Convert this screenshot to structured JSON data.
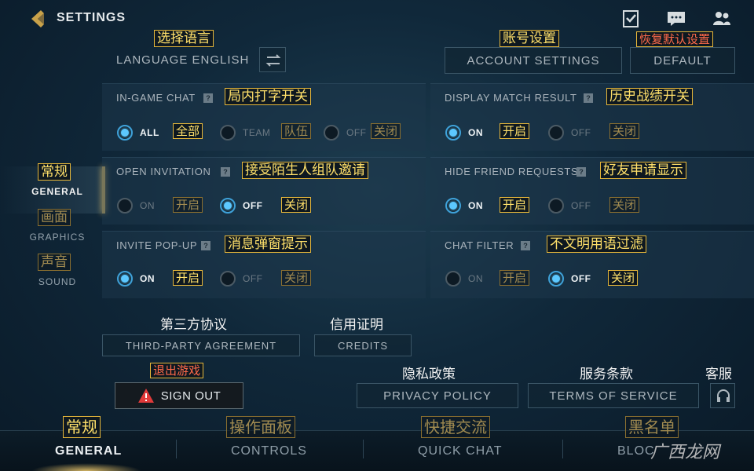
{
  "header": {
    "title": "SETTINGS",
    "icons": [
      "back-icon",
      "checklist-icon",
      "chat-bubble-icon",
      "friends-icon"
    ]
  },
  "top": {
    "language_label": "LANGUAGE ENGLISH",
    "language_cn": "选择语言",
    "swap_icon": "swap-icon",
    "account_settings": "ACCOUNT SETTINGS",
    "account_cn": "账号设置",
    "default": "DEFAULT",
    "default_cn": "恢复默认设置"
  },
  "left_nav": {
    "general": {
      "en": "GENERAL",
      "cn": "常规"
    },
    "graphics": {
      "en": "GRAPHICS",
      "cn": "画面"
    },
    "sound": {
      "en": "SOUND",
      "cn": "声音"
    }
  },
  "options": {
    "ingame_chat": {
      "title": "IN-GAME CHAT",
      "cn": "局内打字开关",
      "opt1": "ALL",
      "opt1_cn": "全部",
      "opt2": "TEAM",
      "opt2_cn": "队伍",
      "opt3": "OFF",
      "opt3_cn": "关闭"
    },
    "display_match": {
      "title": "DISPLAY MATCH RESULT",
      "cn": "历史战绩开关",
      "opt1": "ON",
      "opt1_cn": "开启",
      "opt2": "OFF",
      "opt2_cn": "关闭"
    },
    "open_invitation": {
      "title": "OPEN INVITATION",
      "cn": "接受陌生人组队邀请",
      "opt1": "ON",
      "opt1_cn": "开启",
      "opt2": "OFF",
      "opt2_cn": "关闭"
    },
    "hide_friend": {
      "title": "HIDE FRIEND REQUESTS",
      "cn": "好友申请显示",
      "opt1": "ON",
      "opt1_cn": "开启",
      "opt2": "OFF",
      "opt2_cn": "关闭"
    },
    "invite_popup": {
      "title": "INVITE POP-UP",
      "cn": "消息弹窗提示",
      "opt1": "ON",
      "opt1_cn": "开启",
      "opt2": "OFF",
      "opt2_cn": "关闭"
    },
    "chat_filter": {
      "title": "CHAT FILTER",
      "cn": "不文明用语过滤",
      "opt1": "ON",
      "opt1_cn": "开启",
      "opt2": "OFF",
      "opt2_cn": "关闭"
    }
  },
  "links": {
    "third_party_cn": "第三方协议",
    "third_party": "THIRD-PARTY AGREEMENT",
    "credits_cn": "信用证明",
    "credits": "CREDITS",
    "signout_cn": "退出游戏",
    "signout": "SIGN OUT",
    "privacy_cn": "隐私政策",
    "privacy": "PRIVACY POLICY",
    "terms_cn": "服务条款",
    "terms": "TERMS OF SERVICE",
    "support_cn": "客服"
  },
  "bottom_tabs": {
    "general": {
      "en": "GENERAL",
      "cn": "常规"
    },
    "controls": {
      "en": "CONTROLS",
      "cn": "操作面板"
    },
    "quick_chat": {
      "en": "QUICK CHAT",
      "cn": "快捷交流"
    },
    "block": {
      "en": "BLOC",
      "cn": "黑名单"
    }
  },
  "watermark": "广西龙网",
  "colors": {
    "accent_gold": "#e6b73a",
    "radio_on": "#5cc8ff",
    "warning_red": "#e03a3a"
  }
}
